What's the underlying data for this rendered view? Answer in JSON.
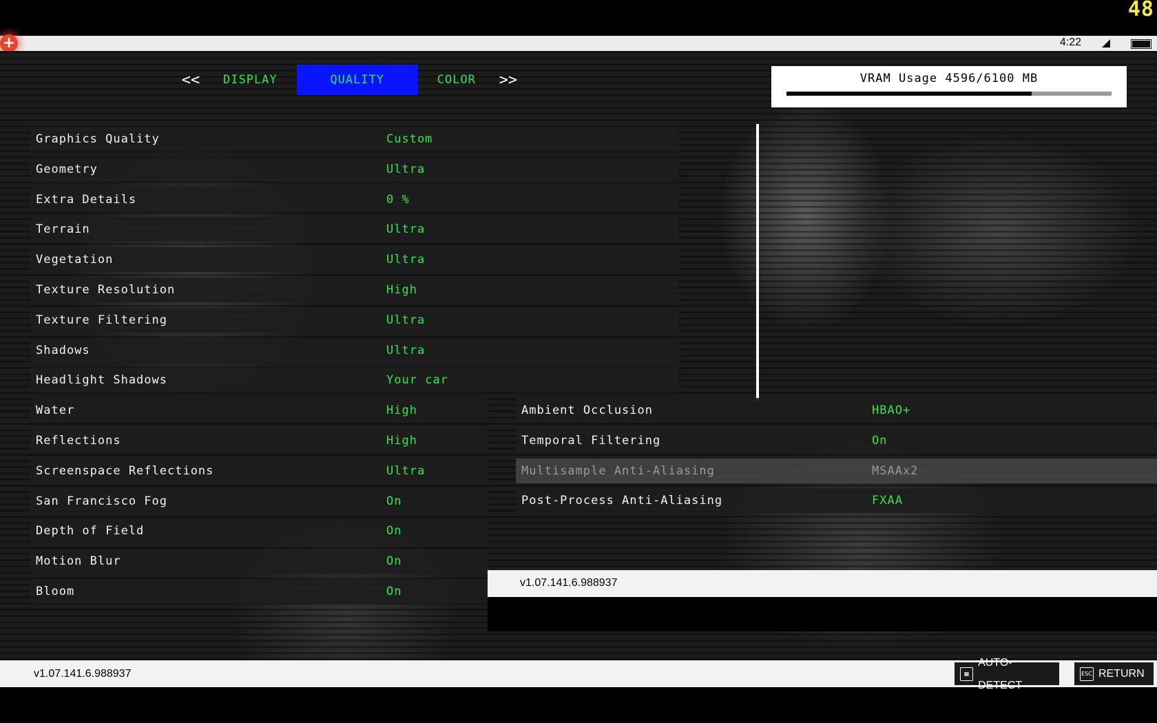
{
  "fps_counter": "48",
  "statusbar": {
    "time": "4:22"
  },
  "tabs": {
    "prev": "<<",
    "next": ">>",
    "items": [
      "DISPLAY",
      "QUALITY",
      "COLOR"
    ],
    "active": "QUALITY"
  },
  "vram": {
    "label": "VRAM Usage 4596/6100 MB",
    "used": 4596,
    "total": 6100
  },
  "settings_left": [
    {
      "name": "Graphics Quality",
      "value": "Custom"
    },
    {
      "name": "Geometry",
      "value": "Ultra"
    },
    {
      "name": "Extra Details",
      "value": "0 %"
    },
    {
      "name": "Terrain",
      "value": "Ultra"
    },
    {
      "name": "Vegetation",
      "value": "Ultra"
    },
    {
      "name": "Texture Resolution",
      "value": "High"
    },
    {
      "name": "Texture Filtering",
      "value": "Ultra"
    },
    {
      "name": "Shadows",
      "value": "Ultra"
    },
    {
      "name": "Headlight Shadows",
      "value": "Your car"
    },
    {
      "name": "Water",
      "value": "High"
    },
    {
      "name": "Reflections",
      "value": "High"
    },
    {
      "name": "Screenspace Reflections",
      "value": "Ultra"
    },
    {
      "name": "San Francisco Fog",
      "value": "On"
    },
    {
      "name": "Depth of Field",
      "value": "On"
    },
    {
      "name": "Motion Blur",
      "value": "On"
    },
    {
      "name": "Bloom",
      "value": "On"
    }
  ],
  "settings_right": [
    {
      "name": "Ambient Occlusion",
      "value": "HBAO+"
    },
    {
      "name": "Temporal Filtering",
      "value": "On"
    },
    {
      "name": "Multisample Anti-Aliasing",
      "value": "MSAAx2",
      "disabled": true
    },
    {
      "name": "Post-Process Anti-Aliasing",
      "value": "FXAA"
    }
  ],
  "version": "v1.07.141.6.988937",
  "buttons": {
    "auto_detect": "AUTO-DETECT",
    "return": "RETURN",
    "esc_icon": "ESC"
  },
  "colors": {
    "accent_green": "#2ee84a",
    "active_tab": "#0a14ff",
    "fps": "#f2e84a"
  }
}
